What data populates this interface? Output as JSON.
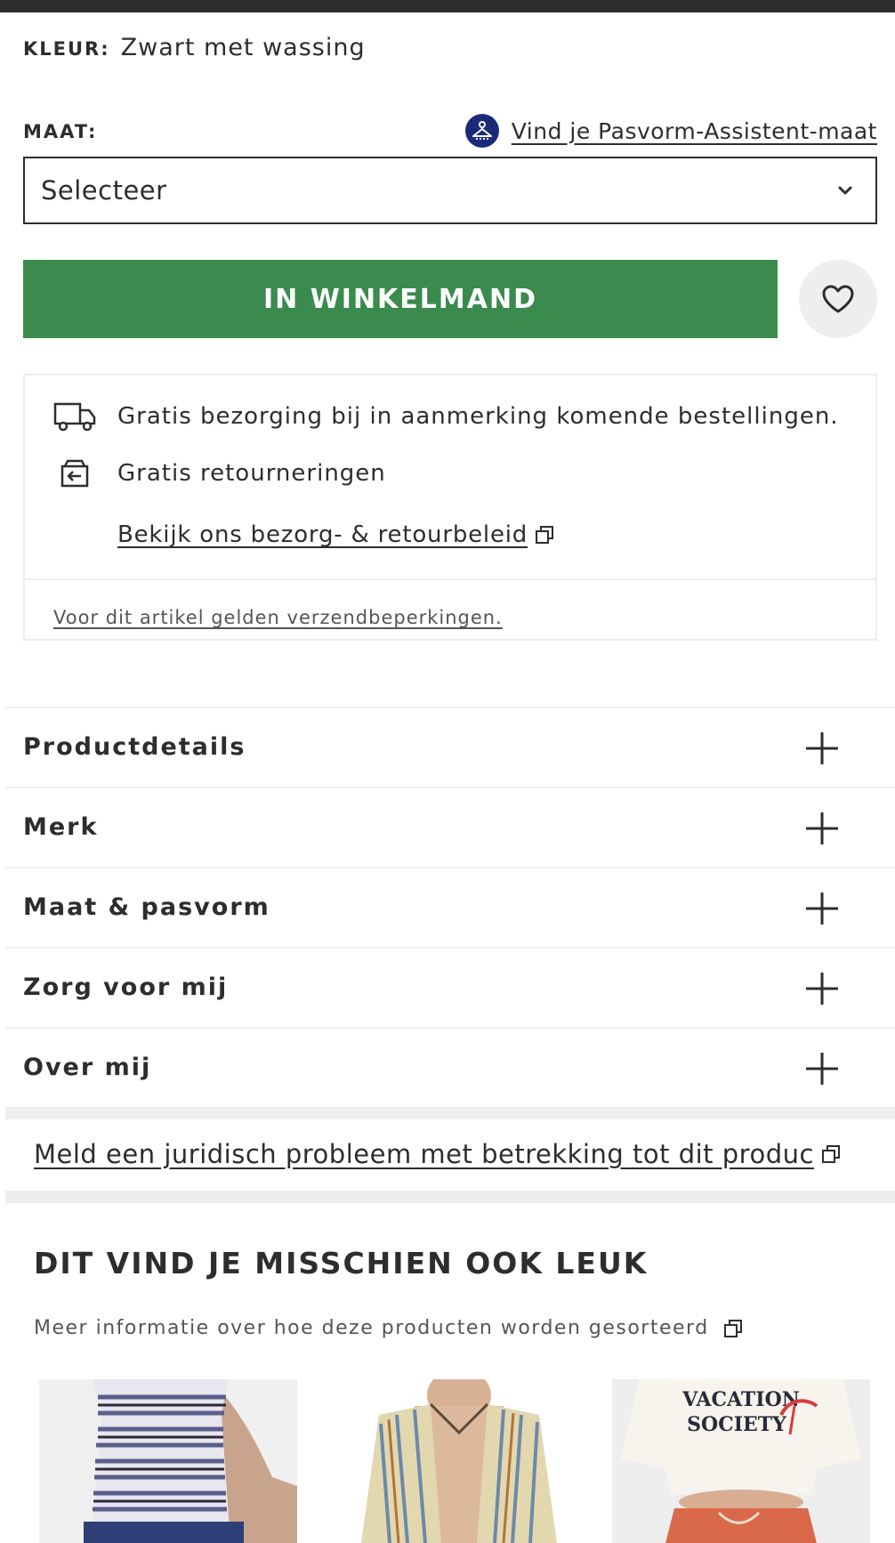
{
  "colour": {
    "label": "KLEUR:",
    "value": "Zwart met wassing"
  },
  "size": {
    "label": "MAAT:",
    "fit_assistant_link": "Vind je Pasvorm-Assistent-maat",
    "select_value": "Selecteer"
  },
  "actions": {
    "add_to_bag": "IN WINKELMAND"
  },
  "delivery": {
    "free_delivery": "Gratis bezorging bij in aanmerking komende bestellingen.",
    "free_returns": "Gratis retourneringen",
    "policy_link": "Bekijk ons bezorg- & retourbeleid",
    "restrictions_link": "Voor dit artikel gelden verzendbeperkingen."
  },
  "accordion": {
    "items": [
      {
        "label": "Productdetails"
      },
      {
        "label": "Merk"
      },
      {
        "label": "Maat & pasvorm"
      },
      {
        "label": "Zorg voor mij"
      },
      {
        "label": "Over mij"
      }
    ]
  },
  "legal": {
    "report_link": "Meld een juridisch probleem met betrekking tot dit produc"
  },
  "recommendations": {
    "title": "DIT VIND JE MISSCHIEN OOK LEUK",
    "subtitle": "Meer informatie over hoe deze producten worden gesorteerd",
    "products": [
      {
        "image": "striped-tank-top-photo"
      },
      {
        "image": "striped-shirt-photo"
      },
      {
        "image": "vacation-society-tee-photo",
        "print_text": "VACATION SOCIETY"
      }
    ]
  },
  "colors": {
    "accent_green": "#3b8a4e",
    "text_dark": "#2d2d2d",
    "border_light": "#eeeeee",
    "fit_icon_bg": "#1b2a78"
  }
}
